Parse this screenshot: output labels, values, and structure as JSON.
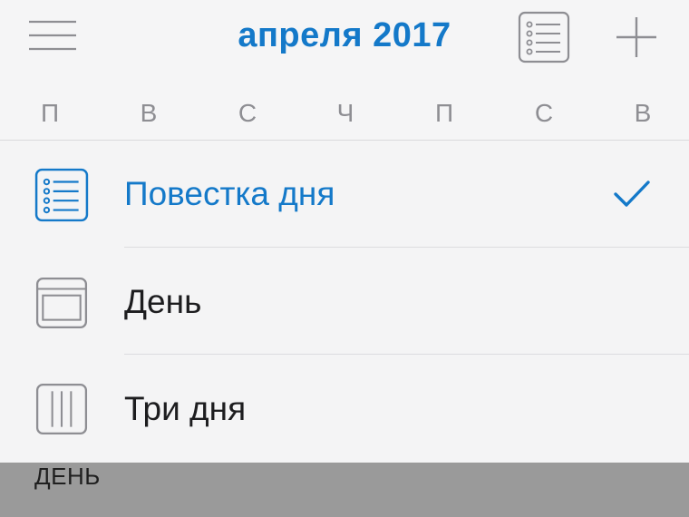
{
  "header": {
    "title": "апреля 2017",
    "menu_icon": "hamburger-icon",
    "list_icon": "list-view-icon",
    "add_icon": "plus-icon"
  },
  "weekdays": [
    "П",
    "В",
    "С",
    "Ч",
    "П",
    "С",
    "В"
  ],
  "view_menu": {
    "items": [
      {
        "label": "Повестка дня",
        "icon": "agenda-icon",
        "selected": true
      },
      {
        "label": "День",
        "icon": "day-view-icon",
        "selected": false
      },
      {
        "label": "Три дня",
        "icon": "three-day-icon",
        "selected": false
      }
    ],
    "check_icon": "checkmark-icon"
  },
  "background_content": {
    "section_label": "ДЕНЬ"
  },
  "colors": {
    "accent": "#1479c9",
    "text": "#1d1d1f",
    "secondary_text": "#8e8e93",
    "icon_gray": "#8e8e93",
    "overlay": "#9a9a9a"
  }
}
